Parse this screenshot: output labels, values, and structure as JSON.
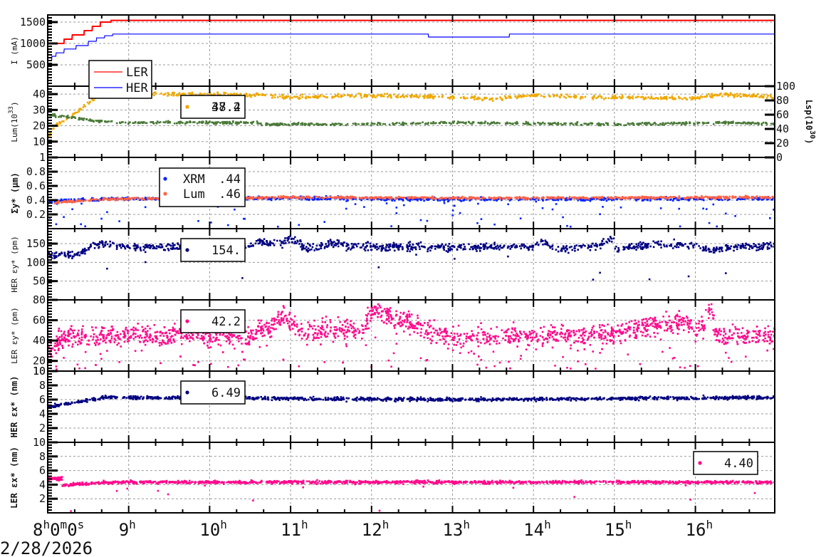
{
  "chart_data": [
    {
      "type": "line",
      "ylabel": "I (mA)",
      "ylim": [
        0,
        1667
      ],
      "yticks": [
        500,
        1000,
        1500
      ],
      "legend": "bottom-left",
      "series": [
        {
          "name": "LER",
          "color": "#ff0000",
          "style": "step",
          "x": [
            8.0,
            8.2,
            8.3,
            8.45,
            8.55,
            8.65,
            8.78,
            10.2,
            10.21,
            17.0
          ],
          "y": [
            1000,
            1100,
            1200,
            1300,
            1400,
            1500,
            1540,
            1540,
            1540,
            1540
          ],
          "noise": 0
        },
        {
          "name": "HER",
          "color": "#0000ff",
          "style": "step",
          "x": [
            8.0,
            8.05,
            8.1,
            8.2,
            8.35,
            8.5,
            8.6,
            8.7,
            8.8,
            12.55,
            12.7,
            13.6,
            13.7,
            17.0
          ],
          "y": [
            600,
            700,
            780,
            870,
            950,
            1050,
            1130,
            1180,
            1220,
            1220,
            1150,
            1150,
            1220,
            1220
          ],
          "noise": 0
        }
      ]
    },
    {
      "type": "scatter",
      "ylabel": "Lum(10^33)",
      "ylabel_base": "Lum(10",
      "ylabel_exp": "33",
      "ylim": [
        0,
        45
      ],
      "yticks": [
        10,
        20,
        30,
        40
      ],
      "y2label": "Lsp(10^30)",
      "y2label_base": "Lsp(10",
      "y2label_exp": "30",
      "y2lim": [
        0,
        100
      ],
      "y2ticks": [
        0,
        20,
        40,
        60,
        80,
        100
      ],
      "legend_values": [
        "38.2",
        "47.4"
      ],
      "series": [
        {
          "name": "Lum orange",
          "color": "#f0a800",
          "x": [
            8.0,
            8.1,
            8.2,
            8.3,
            8.4,
            8.5,
            8.6,
            8.75,
            9.0,
            10.5,
            11.0,
            12.0,
            13.0,
            13.5,
            14.0,
            15.0,
            16.0,
            16.3,
            17.0
          ],
          "y": [
            13,
            20,
            23,
            27,
            30,
            35,
            38,
            41,
            40,
            39.5,
            38,
            39,
            38,
            37,
            39,
            38,
            37.5,
            40,
            38
          ],
          "noise": 0.6,
          "n": 700
        },
        {
          "name": "Lum green",
          "color": "#4a7a38",
          "x": [
            8.0,
            8.3,
            8.6,
            9.0,
            10.5,
            10.7,
            12.0,
            13.0,
            15.0,
            16.5,
            17.0
          ],
          "y": [
            27,
            25,
            23,
            22,
            22,
            21,
            21,
            22,
            21,
            22,
            21
          ],
          "noise": 0.4,
          "n": 700
        }
      ]
    },
    {
      "type": "scatter",
      "ylabel": "Σy* (µm)",
      "ylabel_base": "Σ",
      "ylabel_sub": "y",
      "ylabel_sup": "*",
      "ylabel_unit": " (µm)",
      "ylim": [
        0,
        1
      ],
      "yticks": [
        0.2,
        0.4,
        0.6,
        0.8,
        1
      ],
      "ytick_labels": [
        "0.2",
        "0.4",
        "0.6",
        "0.8",
        "1"
      ],
      "series": [
        {
          "name": "XRM",
          "value": ".44",
          "color": "#0022ff",
          "x": [
            8.0,
            8.5,
            9.0,
            11.0,
            13.0,
            17.0
          ],
          "y": [
            0.38,
            0.41,
            0.42,
            0.43,
            0.41,
            0.42
          ],
          "noise": 0.012,
          "n": 900,
          "outliers": 0.06
        },
        {
          "name": "Lum",
          "value": ".46",
          "color": "#ff6347",
          "x": [
            8.0,
            8.5,
            9.0,
            11.0,
            13.0,
            17.0
          ],
          "y": [
            0.36,
            0.4,
            0.42,
            0.44,
            0.43,
            0.44
          ],
          "noise": 0.008,
          "n": 900,
          "outliers": 0
        }
      ]
    },
    {
      "type": "scatter",
      "ylabel": "HER εy* (pm)",
      "ylim": [
        0,
        190
      ],
      "yticks": [
        50,
        100,
        150
      ],
      "legend_values": [
        "154."
      ],
      "series": [
        {
          "name": "HER εy*",
          "color": "#000080",
          "x": [
            8.0,
            8.4,
            8.55,
            8.7,
            9.0,
            10.0,
            10.5,
            10.6,
            10.9,
            11.0,
            11.2,
            11.5,
            12.0,
            13.0,
            14.0,
            14.12,
            14.3,
            14.5,
            14.8,
            14.95,
            15.05,
            15.5,
            16.0,
            16.2,
            16.4,
            16.8,
            17.0
          ],
          "y": [
            120,
            122,
            145,
            150,
            140,
            142,
            145,
            155,
            150,
            165,
            135,
            150,
            142,
            140,
            142,
            160,
            132,
            140,
            145,
            165,
            135,
            150,
            145,
            128,
            142,
            142,
            150
          ],
          "noise": 5,
          "n": 1100,
          "outliers": 0.01
        }
      ]
    },
    {
      "type": "scatter",
      "ylabel": "LER εy* (pm)",
      "ylim": [
        10,
        80
      ],
      "yticks": [
        10,
        20,
        40,
        60,
        80
      ],
      "legend_values": [
        "42.2"
      ],
      "series": [
        {
          "name": "LER εy*",
          "color": "#ff0a8c",
          "x": [
            8.0,
            8.1,
            8.3,
            9.0,
            10.5,
            10.9,
            11.1,
            11.9,
            12.0,
            13.0,
            15.0,
            15.9,
            16.0,
            16.2,
            16.25,
            17.0
          ],
          "y": [
            28,
            38,
            45,
            46,
            45,
            62,
            50,
            50,
            70,
            43,
            47,
            60,
            45,
            70,
            46,
            44
          ],
          "noise": 5,
          "n": 2200,
          "outliers": 0.07
        }
      ]
    },
    {
      "type": "scatter",
      "ylabel": "HER εx* (nm)",
      "ylim": [
        0,
        10
      ],
      "yticks": [
        2,
        4,
        6,
        8,
        10
      ],
      "legend_values": [
        "6.49"
      ],
      "series": [
        {
          "name": "HER εx*",
          "color": "#000080",
          "x": [
            8.0,
            8.3,
            8.7,
            9.0,
            13.0,
            17.0
          ],
          "y": [
            5.0,
            5.5,
            6.3,
            6.3,
            6.0,
            6.3
          ],
          "noise": 0.12,
          "n": 1200,
          "outliers": 0
        }
      ]
    },
    {
      "type": "scatter",
      "ylabel": "LER εx* (nm)",
      "ylim": [
        0,
        10
      ],
      "yticks": [
        2,
        4,
        6,
        8,
        10
      ],
      "legend_values": [
        "4.40"
      ],
      "series": [
        {
          "name": "LER εx* early",
          "color": "#ff0a8c",
          "x": [
            8.0,
            8.18
          ],
          "y": [
            4.85,
            4.85
          ],
          "noise": 0.12,
          "n": 60,
          "outliers": 0
        },
        {
          "name": "LER εx*",
          "color": "#ff0a8c",
          "x": [
            8.18,
            8.6,
            9.0,
            17.0
          ],
          "y": [
            3.9,
            4.25,
            4.35,
            4.35
          ],
          "noise": 0.1,
          "n": 1300,
          "outliers": 0.01
        }
      ]
    }
  ],
  "xaxis": {
    "range_hours": [
      8.0,
      16.98
    ],
    "first_label": {
      "h": "8",
      "hs": "h",
      "m": "0",
      "ms": "m",
      "s": "0",
      "ss": "s"
    },
    "labels": [
      "9",
      "10",
      "11",
      "12",
      "13",
      "14",
      "15",
      "16"
    ],
    "label_suffix": "h",
    "date": "2/28/2026"
  },
  "legend_panel1": [
    "LER",
    "HER"
  ]
}
